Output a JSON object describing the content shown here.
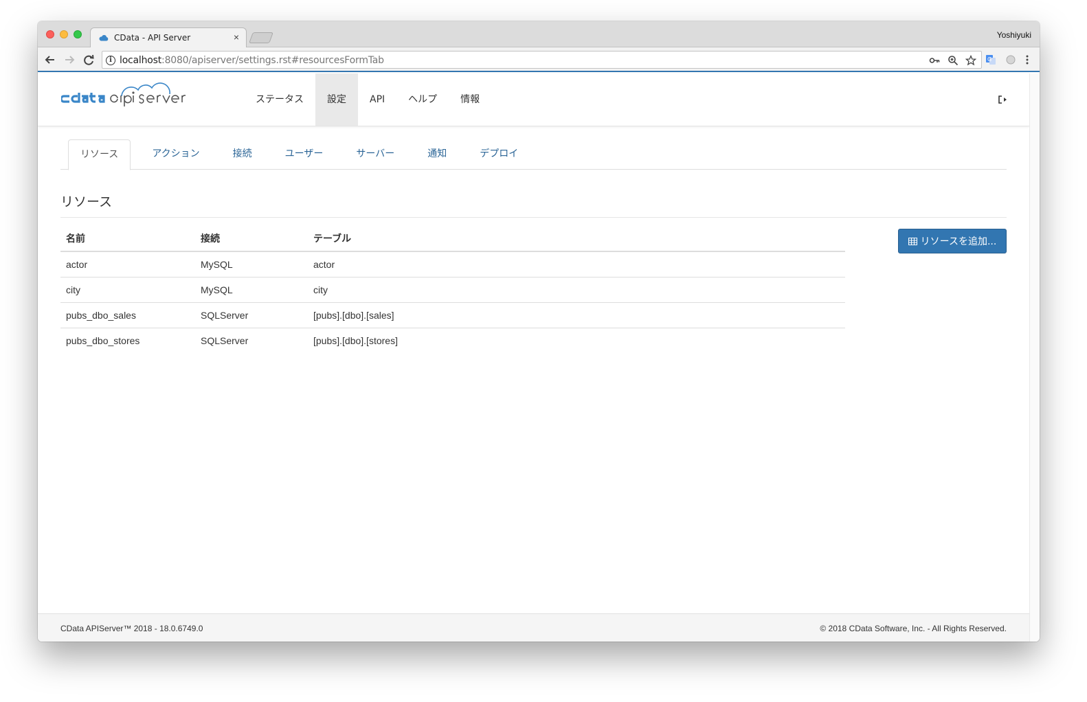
{
  "browser": {
    "tab_title": "CData - API Server",
    "profile_name": "Yoshiyuki",
    "url_host": "localhost",
    "url_rest": ":8080/apiserver/settings.rst#resourcesFormTab"
  },
  "header": {
    "nav": [
      {
        "label": "ステータス",
        "active": false
      },
      {
        "label": "設定",
        "active": true
      },
      {
        "label": "API",
        "active": false
      },
      {
        "label": "ヘルプ",
        "active": false
      },
      {
        "label": "情報",
        "active": false
      }
    ]
  },
  "subtabs": [
    {
      "label": "リソース",
      "active": true
    },
    {
      "label": "アクション",
      "active": false
    },
    {
      "label": "接続",
      "active": false
    },
    {
      "label": "ユーザー",
      "active": false
    },
    {
      "label": "サーバー",
      "active": false
    },
    {
      "label": "通知",
      "active": false
    },
    {
      "label": "デプロイ",
      "active": false
    }
  ],
  "section_title": "リソース",
  "table": {
    "headers": [
      "名前",
      "接続",
      "テーブル"
    ],
    "rows": [
      [
        "actor",
        "MySQL",
        "actor"
      ],
      [
        "city",
        "MySQL",
        "city"
      ],
      [
        "pubs_dbo_sales",
        "SQLServer",
        "[pubs].[dbo].[sales]"
      ],
      [
        "pubs_dbo_stores",
        "SQLServer",
        "[pubs].[dbo].[stores]"
      ]
    ]
  },
  "add_button_label": "リソースを追加...",
  "footer": {
    "left": "CData APIServer™ 2018 - 18.0.6749.0",
    "right": "© 2018 CData Software, Inc. - All Rights Reserved."
  },
  "colors": {
    "accent": "#3276b1",
    "link": "#2a6496",
    "logo_blue": "#3a86c8"
  },
  "icons": {
    "favicon": "cloud-icon",
    "add_button": "table-icon",
    "logout": "sign-out-icon"
  }
}
